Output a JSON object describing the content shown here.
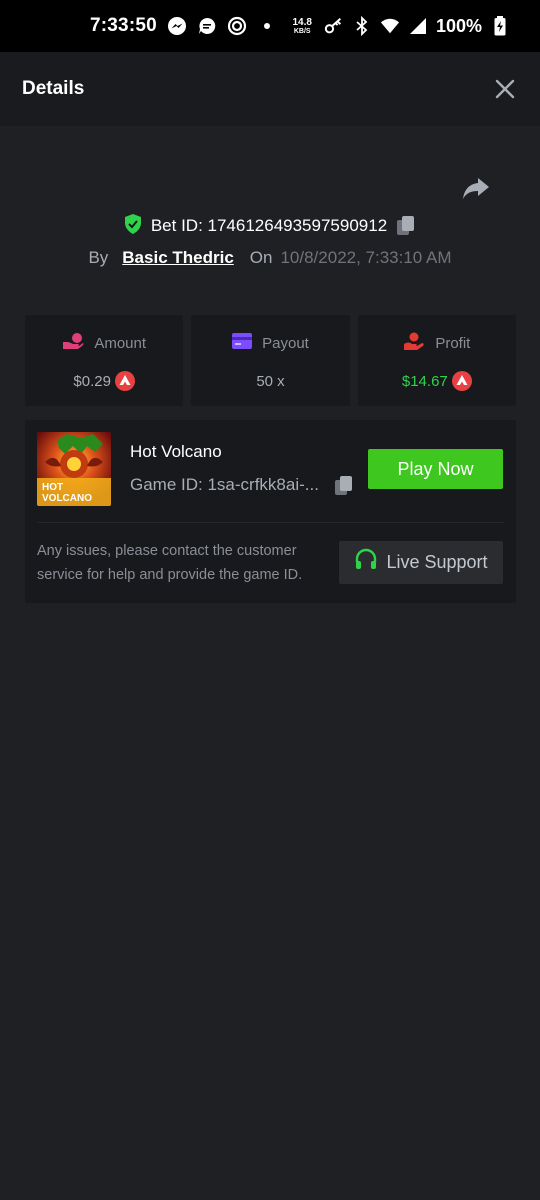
{
  "status_bar": {
    "time": "7:33:50",
    "net_speed_value": "14.8",
    "net_speed_unit": "KB/S",
    "battery": "100%"
  },
  "header": {
    "title": "Details",
    "close_icon": "close-icon"
  },
  "bet": {
    "label": "Bet ID: 1746126493597590912",
    "by_label": "By",
    "username": "Basic Thedric",
    "on_label": "On",
    "date": "10/8/2022, 7:33:10 AM"
  },
  "stats": [
    {
      "title": "Amount",
      "value": "$0.29",
      "icon": "amount-icon",
      "icon_color": "#e0407a",
      "value_color": "#a8adb6"
    },
    {
      "title": "Payout",
      "value": "50 x",
      "icon": "card-icon",
      "icon_color": "#7b4dff",
      "value_color": "#a8adb6"
    },
    {
      "title": "Profit",
      "value": "$14.67",
      "icon": "profit-icon",
      "icon_color": "#e53935",
      "value_color": "#2fd34a"
    }
  ],
  "game": {
    "name": "Hot Volcano",
    "game_id": "Game ID: 1sa-crfkk8ai-...",
    "play_label": "Play Now",
    "thumb_text_line1": "HOT",
    "thumb_text_line2": "VOLCANO",
    "issue_text": "Any issues, please contact the customer service for help and provide the game ID.",
    "support_label": "Live Support"
  },
  "colors": {
    "background": "#1f2023",
    "header_bg": "#1a1b1e",
    "card_bg": "#18191c",
    "play_green": "#3dc71f",
    "profit_green": "#2fd34a"
  }
}
